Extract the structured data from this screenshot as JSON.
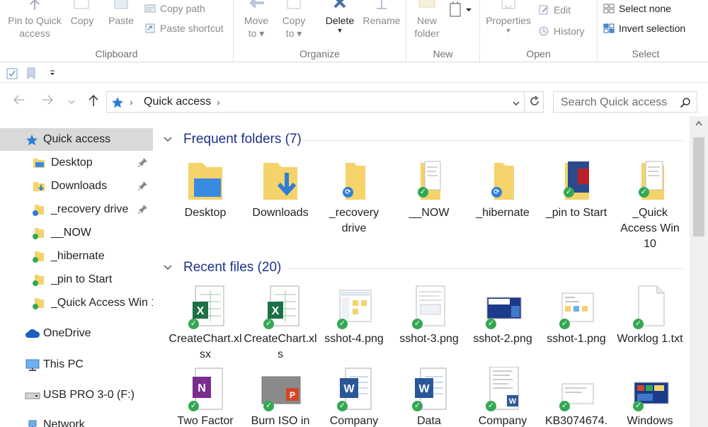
{
  "ribbon": {
    "clipboard": {
      "label": "Clipboard",
      "pin_label": "Pin to Quick\naccess",
      "copy_label": "Copy",
      "paste_label": "Paste",
      "copy_path_label": "Copy path",
      "paste_shortcut_label": "Paste shortcut"
    },
    "organize": {
      "label": "Organize",
      "move_to_label": "Move\nto ▾",
      "copy_to_label": "Copy\nto ▾",
      "delete_label": "Delete",
      "rename_label": "Rename"
    },
    "new": {
      "label": "New",
      "new_folder_label": "New\nfolder"
    },
    "open": {
      "label": "Open",
      "properties_label": "Properties",
      "edit_label": "Edit",
      "history_label": "History"
    },
    "select": {
      "label": "Select",
      "select_none_label": "Select none",
      "invert_selection_label": "Invert selection"
    }
  },
  "address": {
    "location": "Quick access",
    "search_placeholder": "Search Quick access"
  },
  "nav": {
    "items": [
      {
        "label": "Quick access"
      },
      {
        "label": "Desktop"
      },
      {
        "label": "Downloads"
      },
      {
        "label": "_recovery drive"
      },
      {
        "label": "__NOW"
      },
      {
        "label": "_hibernate"
      },
      {
        "label": "_pin to Start"
      },
      {
        "label": "_Quick Access Win 1"
      },
      {
        "label": "OneDrive"
      },
      {
        "label": "This PC"
      },
      {
        "label": "USB PRO 3-0 (F:)"
      },
      {
        "label": "Network"
      }
    ]
  },
  "content": {
    "frequent_title": "Frequent folders (7)",
    "recent_title": "Recent files (20)",
    "frequent": [
      {
        "name": "Desktop"
      },
      {
        "name": "Downloads"
      },
      {
        "name": "_recovery drive"
      },
      {
        "name": "__NOW"
      },
      {
        "name": "_hibernate"
      },
      {
        "name": "_pin to Start"
      },
      {
        "name": "_Quick Access Win 10"
      }
    ],
    "recent_row1": [
      {
        "name": "CreateChart.xlsx"
      },
      {
        "name": "CreateChart.xls"
      },
      {
        "name": "sshot-4.png"
      },
      {
        "name": "sshot-3.png"
      },
      {
        "name": "sshot-2.png"
      },
      {
        "name": "sshot-1.png"
      },
      {
        "name": "Worklog 1.txt"
      }
    ],
    "recent_row2": [
      {
        "name": "Two Factor"
      },
      {
        "name": "Burn ISO in"
      },
      {
        "name": "Company"
      },
      {
        "name": "Data"
      },
      {
        "name": "Company"
      },
      {
        "name": "KB3074674."
      },
      {
        "name": "Windows"
      }
    ]
  },
  "colors": {
    "accent": "#1e3287",
    "folder": "#f5d36b",
    "selected_nav": "#d9d9d9",
    "check": "#33a853",
    "sync": "#2f7dd6"
  }
}
